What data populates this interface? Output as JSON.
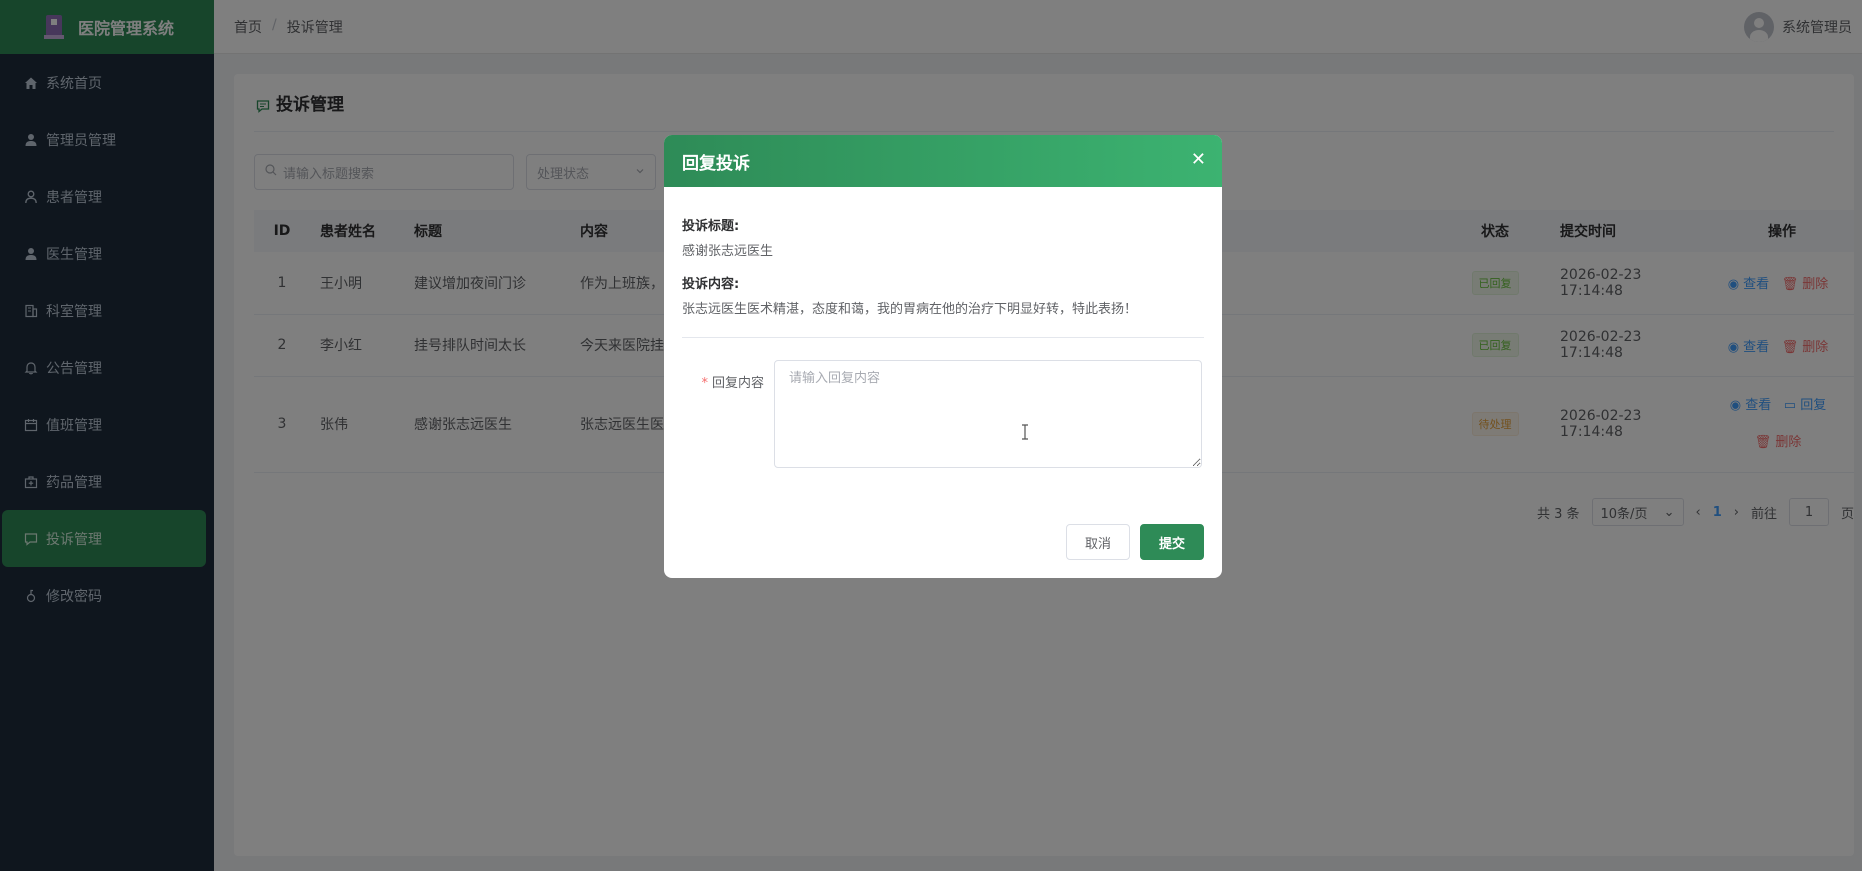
{
  "app": {
    "title": "医院管理系统"
  },
  "sidebar": {
    "items": [
      {
        "label": "系统首页",
        "icon": "home-icon"
      },
      {
        "label": "管理员管理",
        "icon": "user-icon"
      },
      {
        "label": "患者管理",
        "icon": "user-outline-icon"
      },
      {
        "label": "医生管理",
        "icon": "user-icon"
      },
      {
        "label": "科室管理",
        "icon": "building-icon"
      },
      {
        "label": "公告管理",
        "icon": "bell-icon"
      },
      {
        "label": "值班管理",
        "icon": "calendar-icon"
      },
      {
        "label": "药品管理",
        "icon": "medicine-box-icon"
      },
      {
        "label": "投诉管理",
        "icon": "chat-icon",
        "active": true
      },
      {
        "label": "修改密码",
        "icon": "lock-icon"
      }
    ]
  },
  "header": {
    "breadcrumb": [
      "首页",
      "投诉管理"
    ],
    "user": "系统管理员"
  },
  "main": {
    "title": "投诉管理",
    "search_placeholder": "请输入标题搜索",
    "status_placeholder": "处理状态",
    "columns": [
      "ID",
      "患者姓名",
      "标题",
      "内容",
      "状态",
      "提交时间",
      "操作"
    ],
    "rows": [
      {
        "id": "1",
        "patient": "王小明",
        "title": "建议增加夜间门诊",
        "content": "作为上班族，白",
        "status": "已回复",
        "time": "2026-02-23 17:14:48",
        "actions": [
          "查看",
          "删除"
        ]
      },
      {
        "id": "2",
        "patient": "李小红",
        "title": "挂号排队时间太长",
        "content": "今天来医院挂号",
        "status": "已回复",
        "time": "2026-02-23 17:14:48",
        "actions": [
          "查看",
          "删除"
        ]
      },
      {
        "id": "3",
        "patient": "张伟",
        "title": "感谢张志远医生",
        "content": "张志远医生医术",
        "status": "待处理",
        "time": "2026-02-23 17:14:48",
        "actions": [
          "查看",
          "回复",
          "删除"
        ]
      }
    ],
    "pager": {
      "total": "共 3 条",
      "page_size": "10条/页",
      "current": "1",
      "goto_prefix": "前往",
      "goto_value": "1",
      "goto_suffix": "页"
    }
  },
  "dialog": {
    "title": "回复投诉",
    "subject_label": "投诉标题:",
    "subject": "感谢张志远医生",
    "content_label": "投诉内容:",
    "content": "张志远医生医术精湛，态度和蔼，我的胃病在他的治疗下明显好转，特此表扬！",
    "reply_label": "回复内容",
    "reply_placeholder": "请输入回复内容",
    "cancel": "取消",
    "submit": "提交"
  },
  "colors": {
    "brand": "#2e8b57",
    "sidebar": "#1f2d3d",
    "link": "#409eff",
    "danger": "#f56c6c"
  }
}
